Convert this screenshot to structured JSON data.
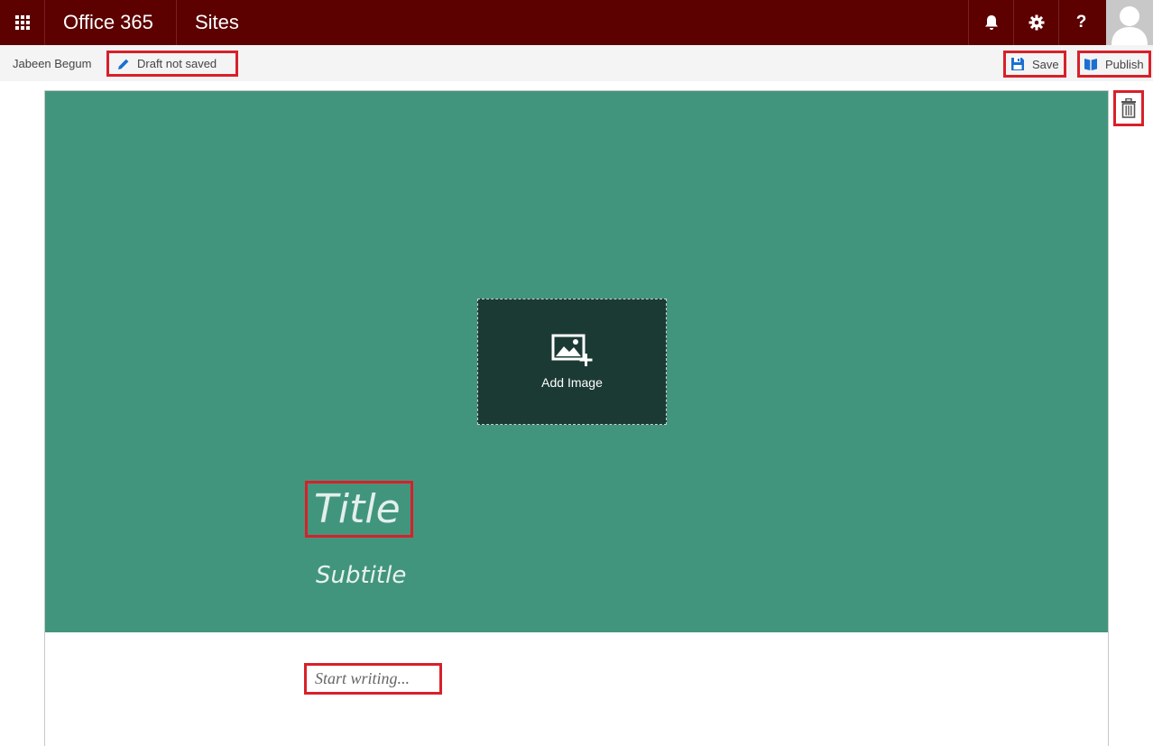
{
  "suitebar": {
    "brand": "Office 365",
    "app": "Sites",
    "help_glyph": "?",
    "colors": {
      "background": "#5c0000"
    },
    "icons": [
      "app-launcher-icon",
      "bell-icon",
      "gear-icon",
      "help-icon",
      "user-avatar-icon"
    ]
  },
  "commandbar": {
    "author": "Jabeen Begum",
    "draft_status": "Draft not saved",
    "save_label": "Save",
    "publish_label": "Publish"
  },
  "hero": {
    "add_image_label": "Add Image",
    "title_placeholder": "Title",
    "subtitle_placeholder": "Subtitle",
    "colors": {
      "background": "#42957d",
      "image_box": "#1b3a33"
    }
  },
  "body": {
    "writing_placeholder": "Start writing..."
  },
  "highlight_color": "#d8202a"
}
